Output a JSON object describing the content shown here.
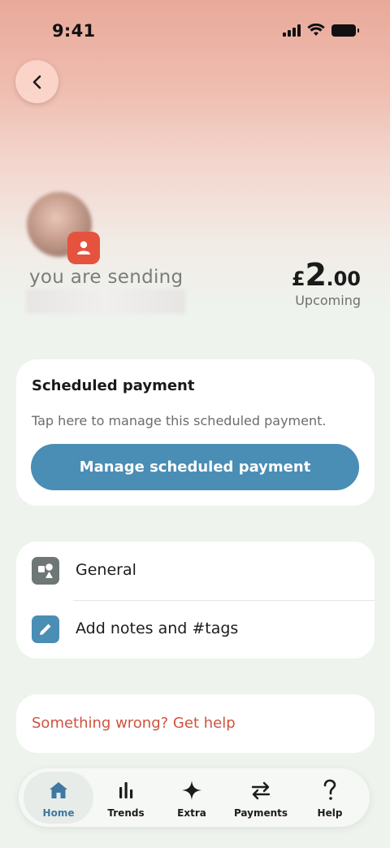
{
  "status_bar": {
    "time": "9:41"
  },
  "recipient": {
    "sending_label": "you are sending",
    "amount_currency": "£",
    "amount_whole": "2",
    "amount_decimal": ".00",
    "amount_status": "Upcoming"
  },
  "scheduled_card": {
    "title": "Scheduled payment",
    "description": "Tap here to manage this scheduled payment.",
    "button_label": "Manage scheduled payment"
  },
  "options": [
    {
      "label": "General",
      "icon": "shapes-icon"
    },
    {
      "label": "Add notes and #tags",
      "icon": "pencil-icon"
    }
  ],
  "help": {
    "link_text": "Something wrong? Get help"
  },
  "tab_bar": {
    "tabs": [
      {
        "label": "Home",
        "icon": "home-icon",
        "active": true
      },
      {
        "label": "Trends",
        "icon": "bar-chart-icon",
        "active": false
      },
      {
        "label": "Extra",
        "icon": "sparkle-icon",
        "active": false
      },
      {
        "label": "Payments",
        "icon": "transfer-arrows-icon",
        "active": false
      },
      {
        "label": "Help",
        "icon": "question-mark-icon",
        "active": false
      }
    ]
  },
  "colors": {
    "accent_blue": "#4a8db5",
    "help_red": "#d0523f",
    "badge_red": "#e5533f",
    "active_tab": "#3e78a3"
  }
}
